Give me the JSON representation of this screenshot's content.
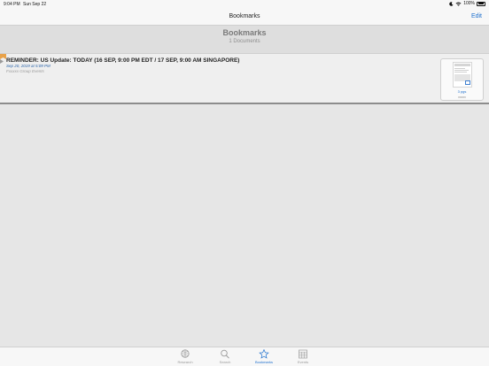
{
  "status_bar": {
    "time": "9:04 PM",
    "date": "Sun Sep 22",
    "battery": "100%"
  },
  "nav": {
    "title": "Bookmarks",
    "edit_label": "Edit"
  },
  "header": {
    "title": "Bookmarks",
    "count": "1 Documents"
  },
  "bookmarks": [
    {
      "headline": "REMINDER: US Update: TODAY (16 SEP, 9:00 PM EDT / 17 SEP, 9:00 AM SINGAPORE)",
      "date": "Sep 20, 2019 at 5:09 PM",
      "source": "Fxxxxx Group Events",
      "thumbnail": {
        "pages": "3 pgs",
        "sub": "xxxxx"
      }
    }
  ],
  "tabs": [
    {
      "label": "Research",
      "icon": "research-icon"
    },
    {
      "label": "Search",
      "icon": "search-icon"
    },
    {
      "label": "Bookmarks",
      "icon": "star-icon",
      "active": true
    },
    {
      "label": "Events",
      "icon": "events-icon"
    }
  ],
  "colors": {
    "accent": "#1d6fce",
    "ribbon": "#e8a24a",
    "background": "#e6e6e6"
  }
}
